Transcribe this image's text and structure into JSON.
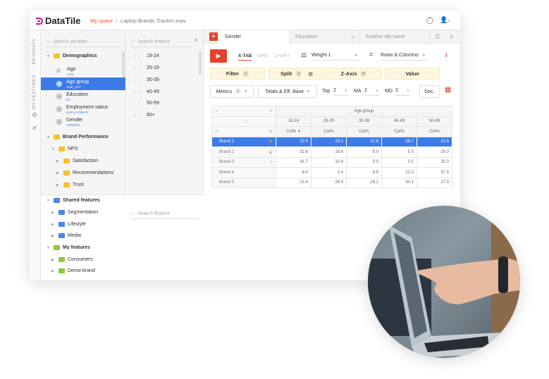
{
  "app": {
    "name": "DataTile",
    "breadcrumb_root": "My space",
    "breadcrumb_file": "Laptop Brands Tracker.zsav"
  },
  "rail": {
    "metadata": "METADATA",
    "my_features": "MY FEATURES"
  },
  "variables": {
    "search_placeholder": "Search variable",
    "groups": {
      "demographics": "Demographics",
      "brand_performance": "Brand Performance",
      "nps": "NPS",
      "satisfaction": "Satisfaction",
      "recommendations": "Recommendations",
      "trust": "Trust",
      "shared": "Shared features",
      "segmentation": "Segmentation",
      "lifestyle": "Lifestyle",
      "media": "Media",
      "my": "My features",
      "consumers": "Consumers",
      "demo_brand": "Demo-brand"
    },
    "items": [
      {
        "name": "Age",
        "code": "AGE"
      },
      {
        "name": "Age group",
        "code": "AGE_CAT"
      },
      {
        "name": "Education",
        "code": "ED"
      },
      {
        "name": "Employment status",
        "code": "EMPLOYMENT"
      },
      {
        "name": "Gender",
        "code": "GENDER"
      }
    ]
  },
  "features": {
    "search_placeholder": "Search feature",
    "search_placeholder_2": "Search feature",
    "items": [
      "18-24",
      "25-29",
      "30-39",
      "40-49",
      "50-59",
      "60+"
    ]
  },
  "tabs": [
    "Gender",
    "Education",
    "Another tab name"
  ],
  "toolbar": {
    "views": [
      "X-TAB",
      "GRID",
      "CHART"
    ],
    "weight": "Weight 1",
    "layout": "Rows & Columns"
  },
  "drops": {
    "filter": "Filter",
    "filter_count": "1",
    "split": "Split",
    "split_count": "3",
    "zaxis": "Z-Axis",
    "zaxis_count": "0",
    "value": "Value"
  },
  "options": {
    "metrics": "Metrics",
    "metrics_count": "0",
    "totals": "Totals & Eff. Base",
    "top_label": "Top",
    "top": "2",
    "ma_label": "MA",
    "ma": "2",
    "md_label": "MD",
    "md": "2",
    "dec": "Dec."
  },
  "table": {
    "group": "Age group",
    "columns": [
      "18-24",
      "25-29",
      "30-39",
      "40-49",
      "50-59"
    ],
    "metric": "Col%",
    "rows": [
      {
        "label": "Brand 1",
        "values": [
          "22.5",
          "23.2",
          "22.8",
          "26.7",
          "22.6"
        ]
      },
      {
        "label": "Brand 2",
        "values": [
          "32.6",
          "18.6",
          "5.0",
          "5.5",
          "25.0"
        ]
      },
      {
        "label": "Brand 3",
        "values": [
          "81.7",
          "10.4",
          "0.0",
          "0.1",
          "30.3"
        ]
      },
      {
        "label": "Brand 4",
        "values": [
          "6.0",
          "1.4",
          "6.5",
          "22.2",
          "37.9"
        ]
      },
      {
        "label": "Brand 5",
        "values": [
          "21.4",
          "29.9",
          "29.2",
          "30.1",
          "27.0"
        ]
      }
    ]
  },
  "colors": {
    "accent": "#e4432e",
    "select": "#3d7be8",
    "folder_yellow": "#f9bf2c",
    "folder_blue": "#4a86e8",
    "folder_green": "#8dc63f"
  }
}
